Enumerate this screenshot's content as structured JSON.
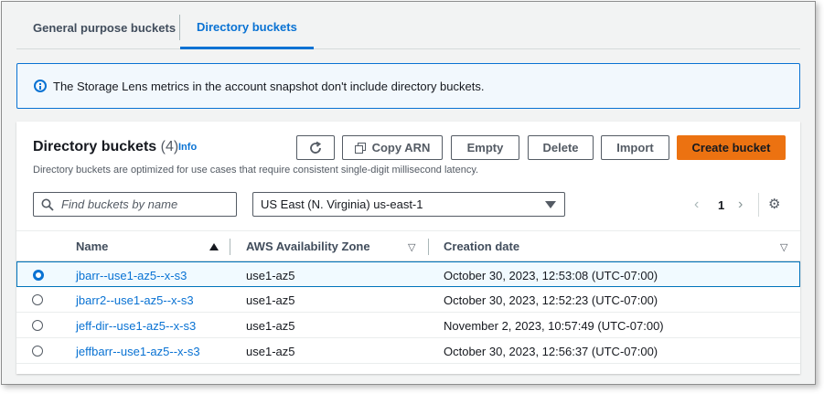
{
  "tabs": [
    {
      "label": "General purpose buckets"
    },
    {
      "label": "Directory buckets"
    }
  ],
  "banner": {
    "text": "The Storage Lens metrics in the account snapshot don't include directory buckets."
  },
  "panel": {
    "title": "Directory buckets",
    "count": "(4)",
    "info_label": "Info",
    "description": "Directory buckets are optimized for use cases that require consistent single-digit millisecond latency."
  },
  "toolbar": {
    "refresh_icon": "refresh-icon",
    "copy_arn": "Copy ARN",
    "empty": "Empty",
    "delete": "Delete",
    "import": "Import",
    "create_bucket": "Create bucket"
  },
  "search": {
    "placeholder": "Find buckets by name"
  },
  "region": {
    "selected": "US East (N. Virginia) us-east-1"
  },
  "pagination": {
    "current_page": "1"
  },
  "table": {
    "columns": [
      "Name",
      "AWS Availability Zone",
      "Creation date"
    ],
    "rows": [
      {
        "name": "jbarr--use1-az5--x-s3",
        "zone": "use1-az5",
        "created": "October 30, 2023, 12:53:08 (UTC-07:00)",
        "selected": true
      },
      {
        "name": "jbarr2--use1-az5--x-s3",
        "zone": "use1-az5",
        "created": "October 30, 2023, 12:52:23 (UTC-07:00)",
        "selected": false
      },
      {
        "name": "jeff-dir--use1-az5--x-s3",
        "zone": "use1-az5",
        "created": "November 2, 2023, 10:57:49 (UTC-07:00)",
        "selected": false
      },
      {
        "name": "jeffbarr--use1-az5--x-s3",
        "zone": "use1-az5",
        "created": "October 30, 2023, 12:56:37 (UTC-07:00)",
        "selected": false
      }
    ]
  },
  "colors": {
    "accent": "#0972d3",
    "primary_button": "#ec7211",
    "selected_row": "#f1faff"
  }
}
